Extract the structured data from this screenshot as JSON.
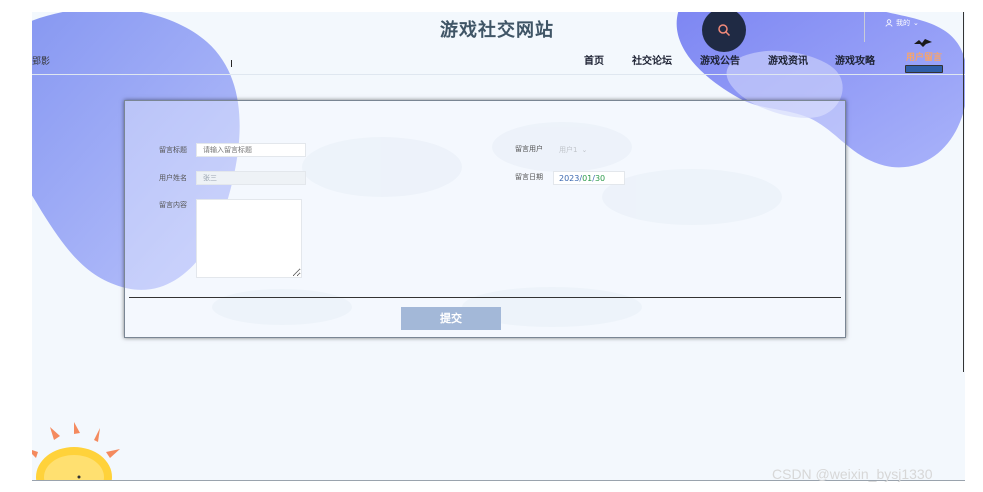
{
  "header": {
    "site_title": "游戏社交网站",
    "left_cut_text": "郢影",
    "user_menu_label": "我的",
    "nav": [
      {
        "label": "首页"
      },
      {
        "label": "社交论坛"
      },
      {
        "label": "游戏公告"
      },
      {
        "label": "游戏资讯"
      },
      {
        "label": "游戏攻略"
      },
      {
        "label": "用户留言"
      }
    ]
  },
  "form": {
    "title_label": "留言标题",
    "title_placeholder": "请输入留言标题",
    "name_label": "用户姓名",
    "name_value": "张三",
    "content_label": "留言内容",
    "user_label": "留言用户",
    "user_selected": "用户1",
    "date_label": "留言日期",
    "date_year": "2023/",
    "date_month": "01",
    "date_sep": "/",
    "date_day": "30",
    "submit_label": "提交"
  },
  "watermark": "CSDN @weixin_bysj1330",
  "colors": {
    "accent_blob": "#8f9cf5",
    "nav_active": "#f5a46e",
    "submit": "#a3b8d8",
    "search_bg": "#1f2a44"
  }
}
